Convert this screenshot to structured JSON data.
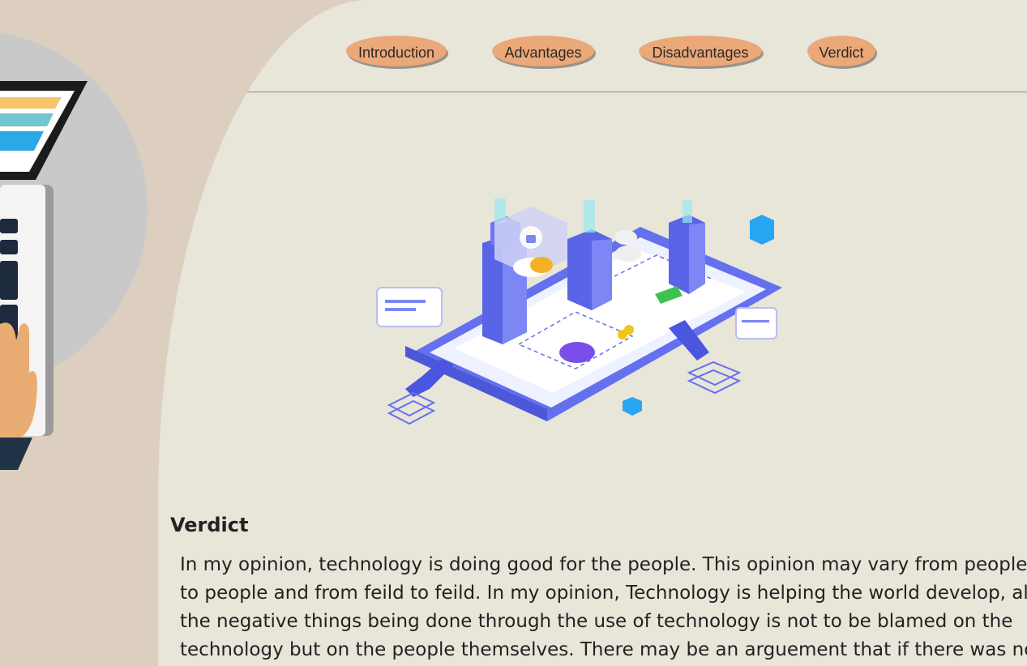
{
  "nav": {
    "items": [
      {
        "label": "Introduction"
      },
      {
        "label": "Advantages"
      },
      {
        "label": "Disadvantages"
      },
      {
        "label": "Verdict"
      }
    ]
  },
  "section": {
    "title": "Verdict",
    "body": "In my opinion, technology is doing good for the people. This opinion may vary from people to people and from feild to feild. In my opinion, Technology is helping the world develop, all the negative things being done through the use of technology is not to be blamed on the technology but on the people themselves. There may be an arguement that if there was no"
  },
  "colors": {
    "background": "#dccfc0",
    "panel": "#e8e5d9",
    "nav_button": "#eba878",
    "accent_blue": "#6470ee"
  }
}
